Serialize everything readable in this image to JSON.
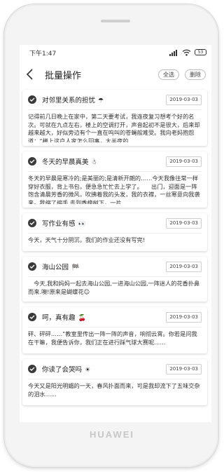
{
  "status_bar": {
    "time": "下午1:47",
    "battery": "53"
  },
  "nav": {
    "title": "批量操作",
    "select_all": "全选",
    "delete": "删除"
  },
  "entries": [
    {
      "title": "对邻里关系的担忧",
      "emoji": "☂",
      "date": "2019-03-03",
      "body": "记得前几日晚上在家中，第二天要考试，我连夜复习想考个好的名次。可就在九点左右，楼上的空调打开，声音起初不是很大，后来却越来越大，好似旁边有个一直在呜叫的苍蝇般难受。我向老妈抱怨道：“楼上这户人家怎么回事，大半夜的……"
    },
    {
      "title": "冬天的早晨真美",
      "emoji": "☃",
      "date": "2019-03-03",
      "body": "冬天的早晨是寒冷的;是美丽的;是清新开朗的……今天我像往常一样穿好衣服，背上书包，便急急忙忙去上学了。　　出门，迎面是一阵饱含清晨芳香的微风，吹拂着我的头发，我的衣襟，一丝寒意向我袭来。我缩了缩手,走到香樟树下，一片……"
    },
    {
      "title": "写作业有感",
      "emoji": "👀",
      "date": "2019-03-03",
      "body": "今天，天气十分阴沉，我们的作业还没有写完!"
    },
    {
      "title": "海山公园",
      "emoji": "🏁",
      "date": "2019-03-03",
      "body": "　今天,我和妈妈一起去海山公园,一进海山公园,一阵迷人的花香扑鼻而来.噢!原来是蝴蝶花☺"
    },
    {
      "title": "呵，真有趣",
      "emoji": "🍒",
      "date": "2019-03-03",
      "body": "砰、砰砰……”教室里传出一阵一阵的声音，响彻云霄。你若是问我在干嘛，我便告诉你，我们正在进行踩气球大赛呢……"
    },
    {
      "title": "你读了会哭吗",
      "emoji": "☀",
      "date": "2019-03-03",
      "body": "今天又是阳光明媚的一天，春风扑面而来，可是我却流下了五味交杂的泪水……"
    }
  ]
}
